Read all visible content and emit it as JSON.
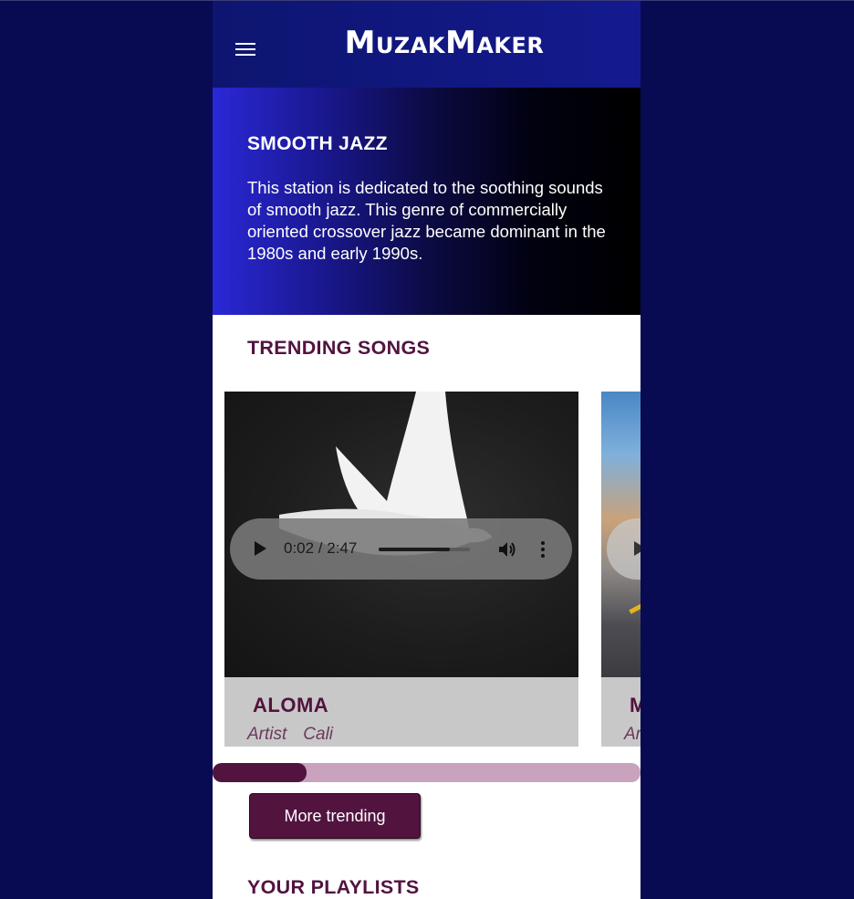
{
  "app": {
    "title": "MuzakMaker",
    "menu_icon": "hamburger-menu-icon"
  },
  "colors": {
    "page_background": "#080b52",
    "appbar": "#141a8e",
    "accent": "#52133f",
    "scrollbar_track": "#c9a3bd"
  },
  "station": {
    "title": "SMOOTH JAZZ",
    "description": "This station is dedicated to the soothing sounds of smooth jazz. This genre of commercially oriented crossover jazz became dominant in the 1980s and early 1990s."
  },
  "trending": {
    "section_title": "TRENDING SONGS",
    "songs": [
      {
        "title": "ALOMA",
        "artist_label": "Artist",
        "artist": "Cali",
        "image": "white dove in flight",
        "player": {
          "time": "0:02 / 2:47",
          "progress": 0.78
        }
      },
      {
        "title": "M",
        "artist_label": "Ar",
        "artist": "",
        "image": "desert road",
        "player": {
          "time": "",
          "progress": 0
        }
      }
    ],
    "carousel_scroll_position": 0.22,
    "more_button_label": "More trending"
  },
  "playlists": {
    "section_title": "YOUR PLAYLISTS"
  }
}
